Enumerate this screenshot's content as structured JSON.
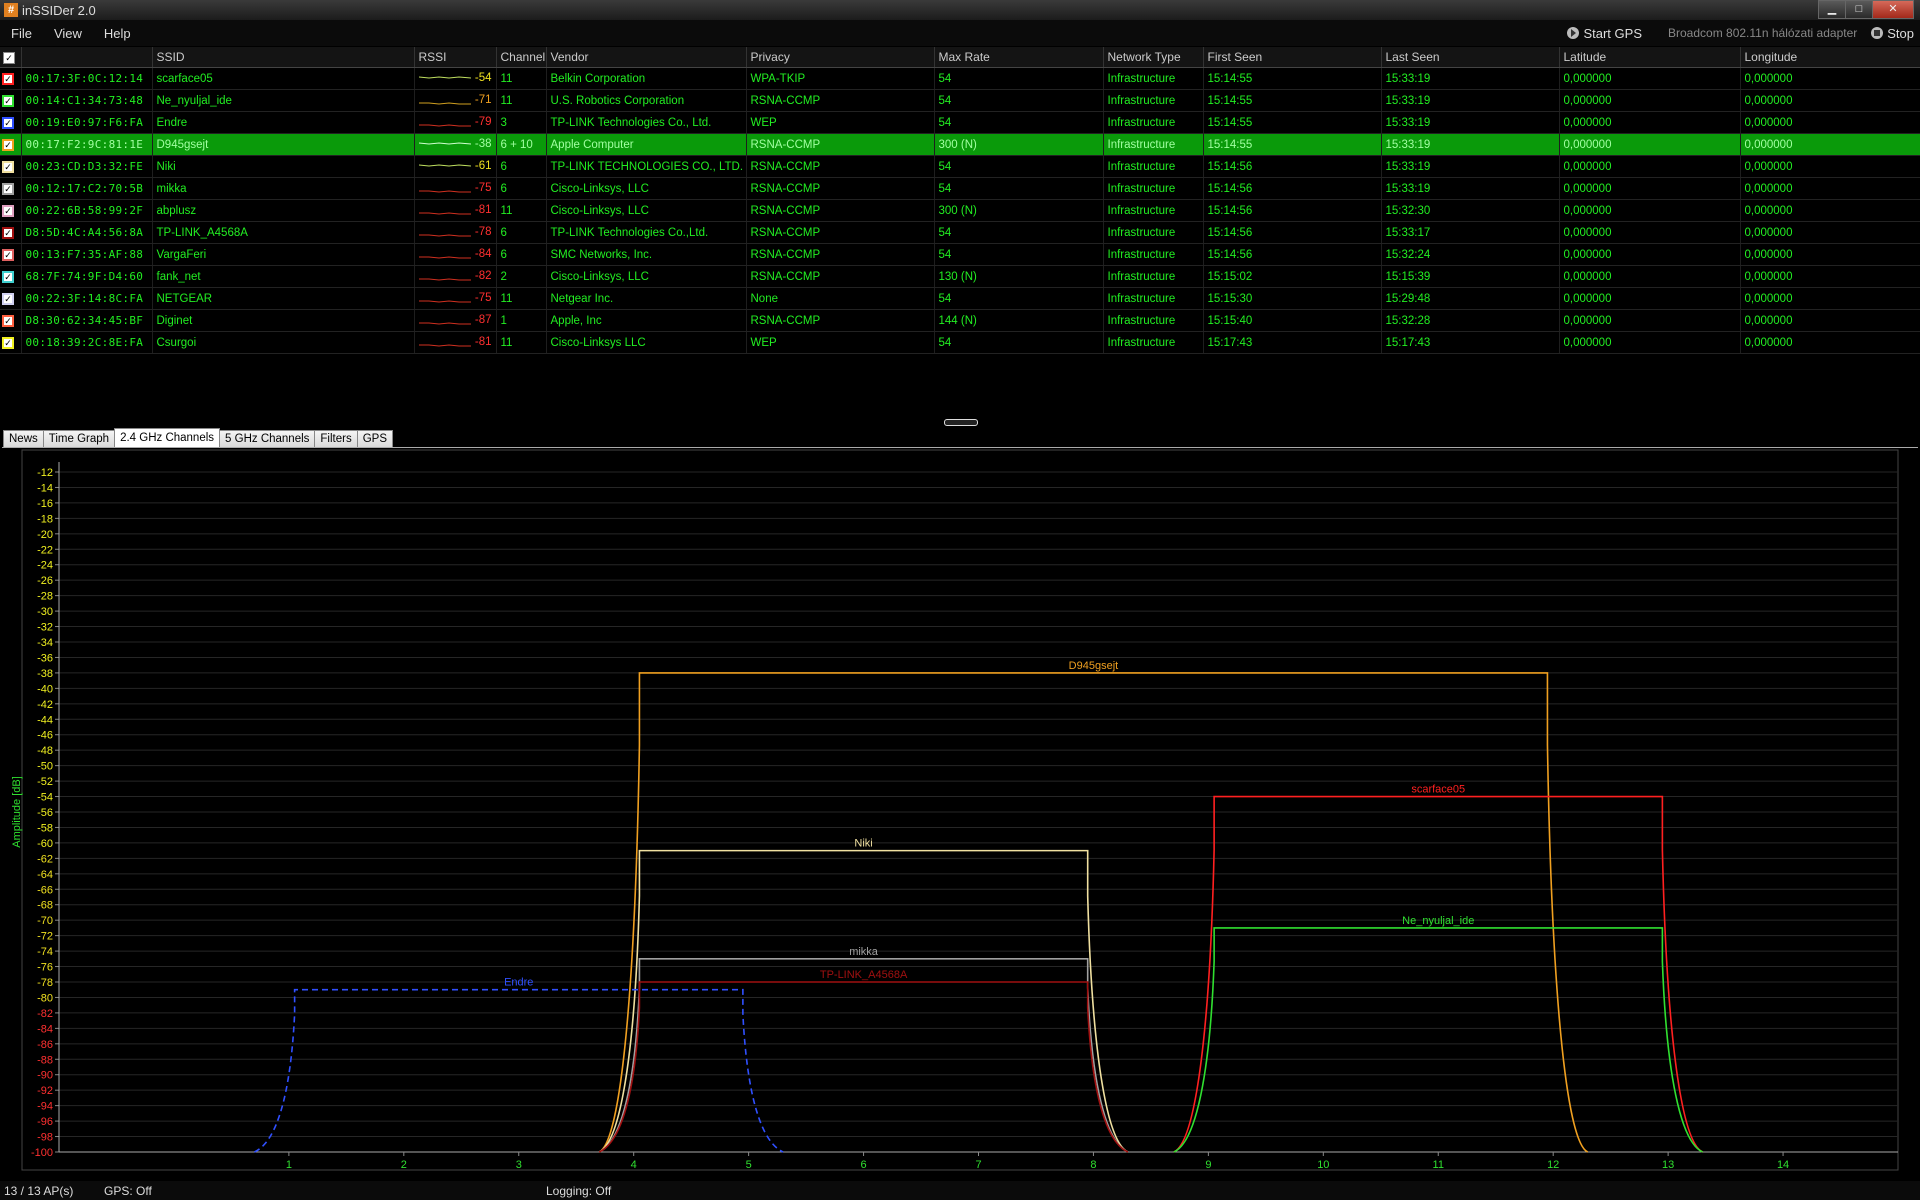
{
  "window": {
    "title": "inSSIDer 2.0",
    "icon_text": "#"
  },
  "menu": [
    "File",
    "View",
    "Help"
  ],
  "toolbar": {
    "start_gps": "Start GPS",
    "adapter": "Broadcom 802.11n hálózati adapter",
    "stop": "Stop"
  },
  "columns": [
    "SSID",
    "RSSI",
    "Channel",
    "Vendor",
    "Privacy",
    "Max Rate",
    "Network Type",
    "First Seen",
    "Last Seen",
    "Latitude",
    "Longitude"
  ],
  "networks": [
    {
      "color": "#ff2020",
      "mac": "00:17:3F:0C:12:14",
      "ssid": "scarface05",
      "rssi": "-54",
      "channel": "11",
      "vendor": "Belkin Corporation",
      "privacy": "WPA-TKIP",
      "rate": "54",
      "type": "Infrastructure",
      "first": "15:14:55",
      "last": "15:33:19",
      "lat": "0,000000",
      "lon": "0,000000"
    },
    {
      "color": "#30e030",
      "mac": "00:14:C1:34:73:48",
      "ssid": "Ne_nyuljal_ide",
      "rssi": "-71",
      "channel": "11",
      "vendor": "U.S. Robotics Corporation",
      "privacy": "RSNA-CCMP",
      "rate": "54",
      "type": "Infrastructure",
      "first": "15:14:55",
      "last": "15:33:19",
      "lat": "0,000000",
      "lon": "0,000000"
    },
    {
      "color": "#3050ff",
      "mac": "00:19:E0:97:F6:FA",
      "ssid": "Endre",
      "rssi": "-79",
      "channel": "3",
      "vendor": "TP-LINK Technologies Co., Ltd.",
      "privacy": "WEP",
      "rate": "54",
      "type": "Infrastructure",
      "first": "15:14:55",
      "last": "15:33:19",
      "lat": "0,000000",
      "lon": "0,000000"
    },
    {
      "color": "#f0a020",
      "mac": "00:17:F2:9C:81:1E",
      "ssid": "D945gsejt",
      "rssi": "-38",
      "channel": "6 + 10",
      "vendor": "Apple Computer",
      "privacy": "RSNA-CCMP",
      "rate": "300 (N)",
      "type": "Infrastructure",
      "first": "15:14:55",
      "last": "15:33:19",
      "lat": "0,000000",
      "lon": "0,000000",
      "selected": true
    },
    {
      "color": "#f0e0a0",
      "mac": "00:23:CD:D3:32:FE",
      "ssid": "Niki",
      "rssi": "-61",
      "channel": "6",
      "vendor": "TP-LINK TECHNOLOGIES CO., LTD.",
      "privacy": "RSNA-CCMP",
      "rate": "54",
      "type": "Infrastructure",
      "first": "15:14:56",
      "last": "15:33:19",
      "lat": "0,000000",
      "lon": "0,000000"
    },
    {
      "color": "#a0a0a0",
      "mac": "00:12:17:C2:70:5B",
      "ssid": "mikka",
      "rssi": "-75",
      "channel": "6",
      "vendor": "Cisco-Linksys, LLC",
      "privacy": "RSNA-CCMP",
      "rate": "54",
      "type": "Infrastructure",
      "first": "15:14:56",
      "last": "15:33:19",
      "lat": "0,000000",
      "lon": "0,000000"
    },
    {
      "color": "#e0a0c0",
      "mac": "00:22:6B:58:99:2F",
      "ssid": "abplusz",
      "rssi": "-81",
      "channel": "11",
      "vendor": "Cisco-Linksys, LLC",
      "privacy": "RSNA-CCMP",
      "rate": "300 (N)",
      "type": "Infrastructure",
      "first": "15:14:56",
      "last": "15:32:30",
      "lat": "0,000000",
      "lon": "0,000000"
    },
    {
      "color": "#a01010",
      "mac": "D8:5D:4C:A4:56:8A",
      "ssid": "TP-LINK_A4568A",
      "rssi": "-78",
      "channel": "6",
      "vendor": "TP-LINK Technologies Co.,Ltd.",
      "privacy": "RSNA-CCMP",
      "rate": "54",
      "type": "Infrastructure",
      "first": "15:14:56",
      "last": "15:33:17",
      "lat": "0,000000",
      "lon": "0,000000"
    },
    {
      "color": "#e06060",
      "mac": "00:13:F7:35:AF:88",
      "ssid": "VargaFeri",
      "rssi": "-84",
      "channel": "6",
      "vendor": "SMC Networks, Inc.",
      "privacy": "RSNA-CCMP",
      "rate": "54",
      "type": "Infrastructure",
      "first": "15:14:56",
      "last": "15:32:24",
      "lat": "0,000000",
      "lon": "0,000000"
    },
    {
      "color": "#40d0d0",
      "mac": "68:7F:74:9F:D4:60",
      "ssid": "fank_net",
      "rssi": "-82",
      "channel": "2",
      "vendor": "Cisco-Linksys, LLC",
      "privacy": "RSNA-CCMP",
      "rate": "130 (N)",
      "type": "Infrastructure",
      "first": "15:15:02",
      "last": "15:15:39",
      "lat": "0,000000",
      "lon": "0,000000"
    },
    {
      "color": "#d0d0f0",
      "mac": "00:22:3F:14:8C:FA",
      "ssid": "NETGEAR",
      "rssi": "-75",
      "channel": "11",
      "vendor": "Netgear Inc.",
      "privacy": "None",
      "rate": "54",
      "type": "Infrastructure",
      "first": "15:15:30",
      "last": "15:29:48",
      "lat": "0,000000",
      "lon": "0,000000"
    },
    {
      "color": "#ff6040",
      "mac": "D8:30:62:34:45:BF",
      "ssid": "Diginet",
      "rssi": "-87",
      "channel": "1",
      "vendor": "Apple, Inc",
      "privacy": "RSNA-CCMP",
      "rate": "144 (N)",
      "type": "Infrastructure",
      "first": "15:15:40",
      "last": "15:32:28",
      "lat": "0,000000",
      "lon": "0,000000"
    },
    {
      "color": "#f0f020",
      "mac": "00:18:39:2C:8E:FA",
      "ssid": "Csurgoi",
      "rssi": "-81",
      "channel": "11",
      "vendor": "Cisco-Linksys LLC",
      "privacy": "WEP",
      "rate": "54",
      "type": "Infrastructure",
      "first": "15:17:43",
      "last": "15:17:43",
      "lat": "0,000000",
      "lon": "0,000000"
    }
  ],
  "tabs": [
    "News",
    "Time Graph",
    "2.4 GHz Channels",
    "5 GHz Channels",
    "Filters",
    "GPS"
  ],
  "active_tab": "2.4 GHz Channels",
  "chart_data": {
    "type": "line",
    "ylabel": "Amplitude [dB]",
    "ylim": [
      -100,
      -12
    ],
    "yticks": [
      -12,
      -14,
      -16,
      -18,
      -20,
      -22,
      -24,
      -26,
      -28,
      -30,
      -32,
      -34,
      -36,
      -38,
      -40,
      -42,
      -44,
      -46,
      -48,
      -50,
      -52,
      -54,
      -56,
      -58,
      -60,
      -62,
      -64,
      -66,
      -68,
      -70,
      -72,
      -74,
      -76,
      -78,
      -80,
      -82,
      -84,
      -86,
      -88,
      -90,
      -92,
      -94,
      -96,
      -98,
      -100
    ],
    "xticks": [
      1,
      2,
      3,
      4,
      5,
      6,
      7,
      8,
      9,
      10,
      11,
      12,
      13,
      14
    ],
    "xlim": [
      -1,
      15
    ],
    "ytick_colors": {
      "high": "#f0f020",
      "mid": "#f0f020",
      "low": "#ff3030"
    },
    "grid": true,
    "series": [
      {
        "name": "D945gsejt",
        "color": "#f0a020",
        "channel": 8,
        "width": 8,
        "rssi": -38,
        "dashed": false
      },
      {
        "name": "scarface05",
        "color": "#ff2020",
        "channel": 11,
        "width": 4,
        "rssi": -54,
        "dashed": false
      },
      {
        "name": "Niki",
        "color": "#f0e0a0",
        "channel": 6,
        "width": 4,
        "rssi": -61,
        "dashed": false
      },
      {
        "name": "Ne_nyuljal_ide",
        "color": "#30e030",
        "channel": 11,
        "width": 4,
        "rssi": -71,
        "dashed": false
      },
      {
        "name": "mikka",
        "color": "#a0a0a0",
        "channel": 6,
        "width": 4,
        "rssi": -75,
        "dashed": false
      },
      {
        "name": "TP-LINK_A4568A",
        "color": "#a01010",
        "channel": 6,
        "width": 4,
        "rssi": -78,
        "dashed": false
      },
      {
        "name": "Endre",
        "color": "#3050ff",
        "channel": 3,
        "width": 4,
        "rssi": -79,
        "dashed": true
      }
    ]
  },
  "status": {
    "count": "13 / 13 AP(s)",
    "gps": "GPS: Off",
    "logging": "Logging: Off"
  }
}
